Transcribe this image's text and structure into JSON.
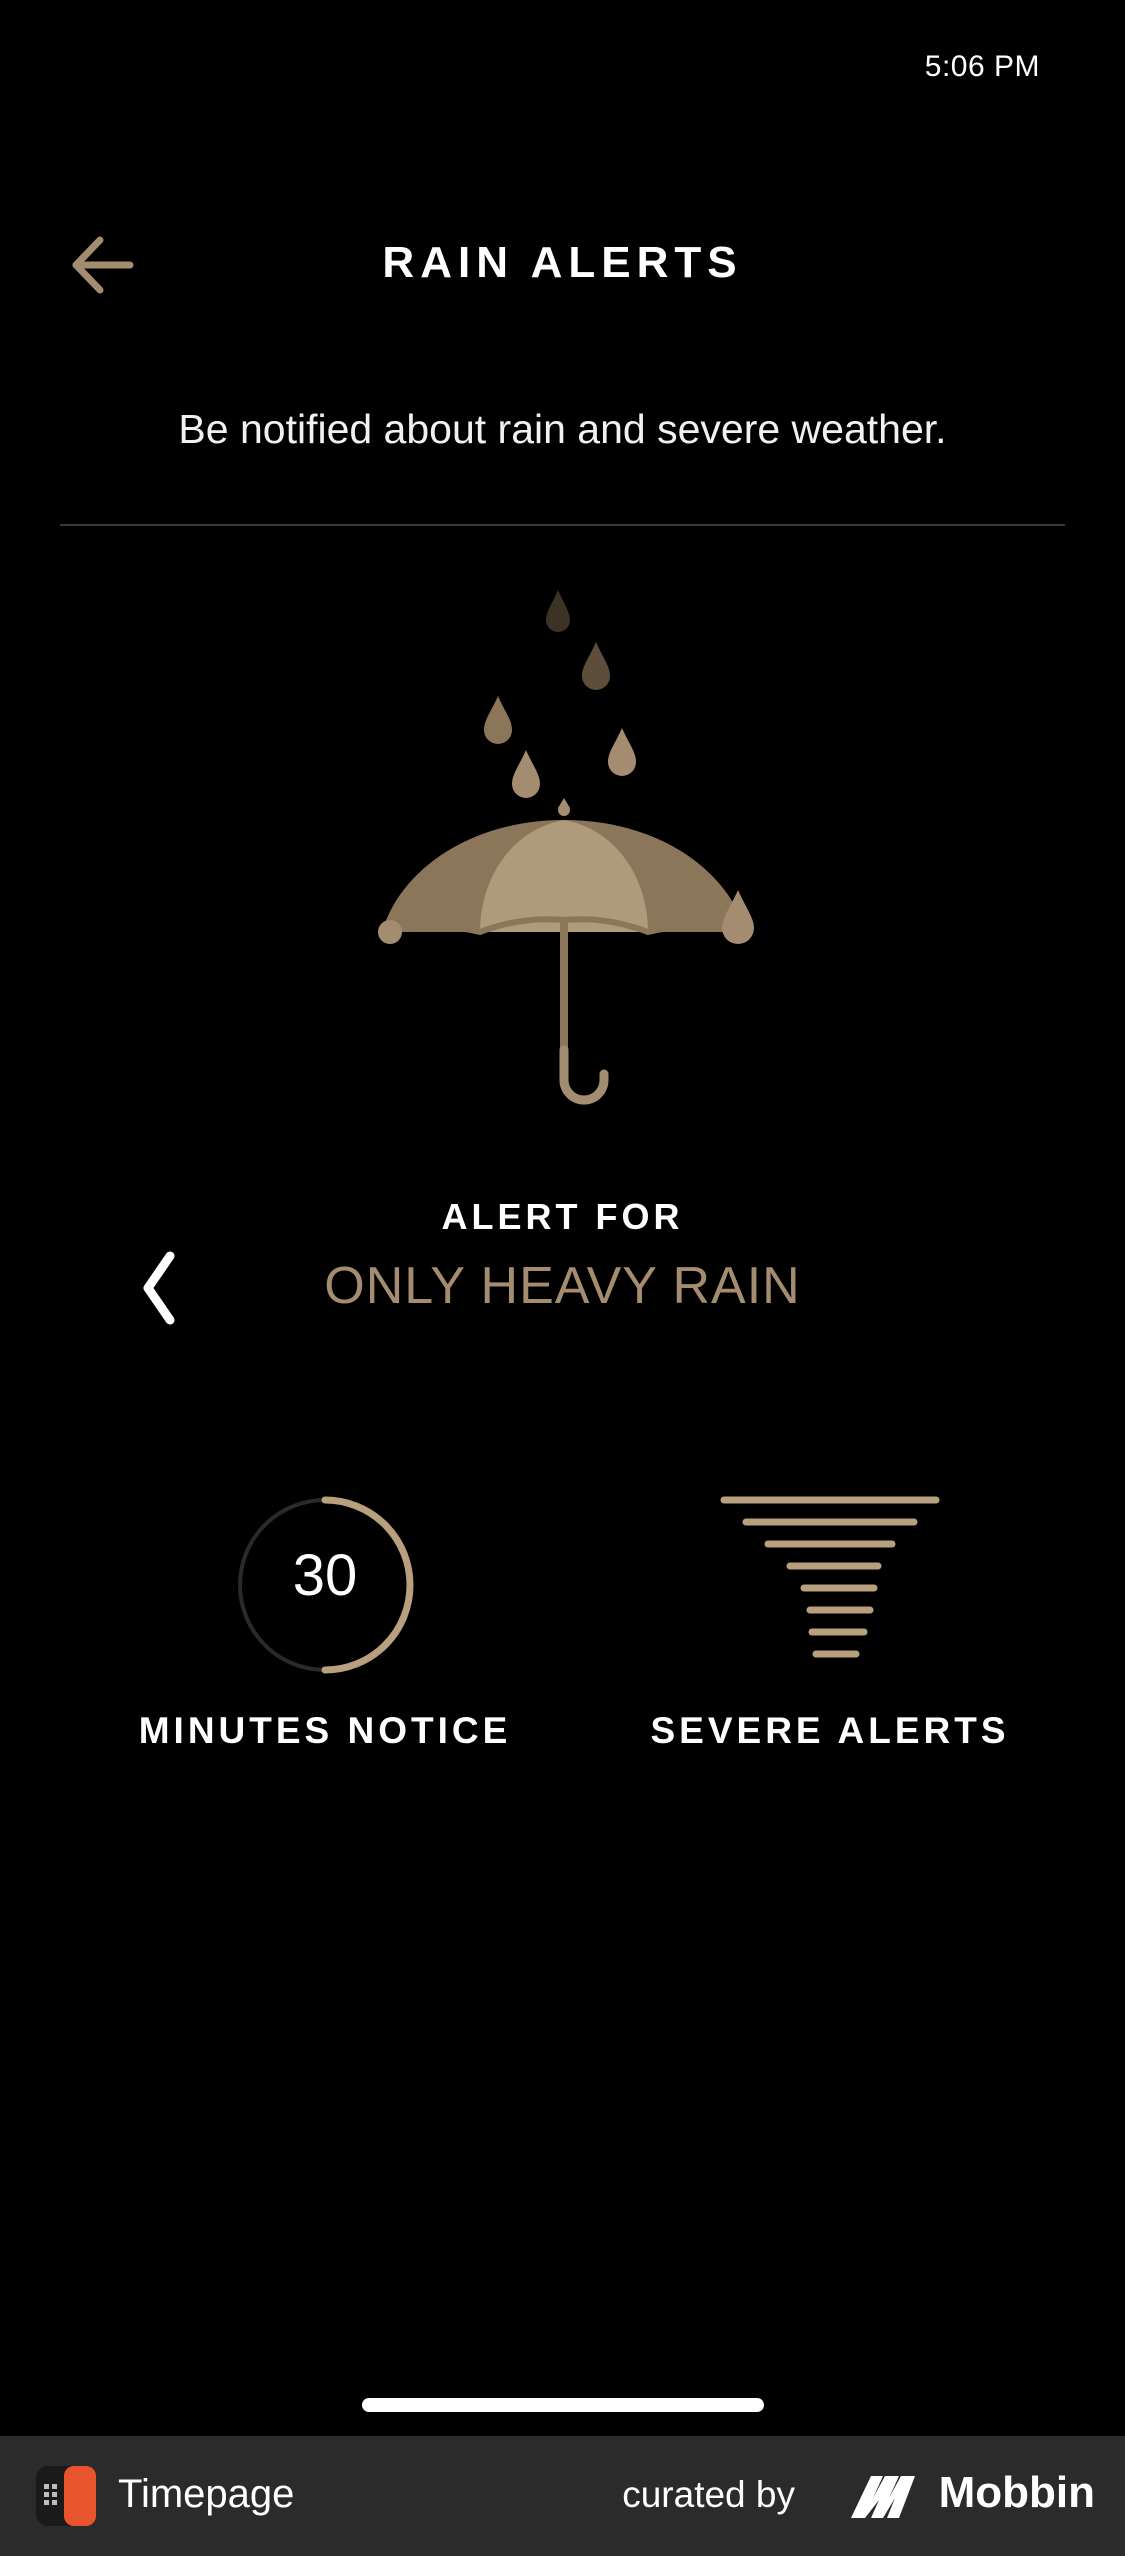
{
  "status_bar": {
    "time": "5:06 PM"
  },
  "header": {
    "title": "RAIN ALERTS",
    "back_icon": "arrow-left-icon"
  },
  "description": "Be notified about rain and severe weather.",
  "alert_for": {
    "label": "ALERT FOR",
    "value": "ONLY HEAVY RAIN",
    "prev_icon": "chevron-left-icon"
  },
  "minutes_notice": {
    "value": "30",
    "label": "MINUTES NOTICE",
    "fraction": 0.5
  },
  "severe_alerts": {
    "label": "SEVERE ALERTS",
    "icon": "tornado-icon"
  },
  "footer": {
    "app_name": "Timepage",
    "curated_by": "curated by",
    "brand": "Mobbin"
  },
  "colors": {
    "background": "#000000",
    "accent": "#a48c70",
    "accent_light": "#b8a07f",
    "text": "#ffffff",
    "footer_bg": "#2b2b2b",
    "app_logo": "#e8552d"
  }
}
